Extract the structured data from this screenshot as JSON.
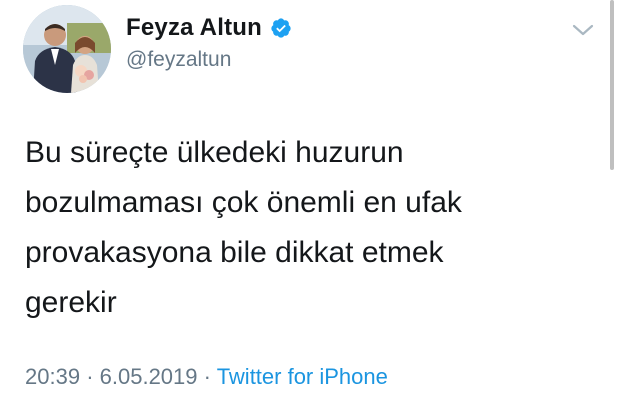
{
  "author": {
    "display_name": "Feyza Altun",
    "handle": "@feyzaltun",
    "verified": true,
    "verified_color": "#1da1f2"
  },
  "tweet": {
    "lines": [
      "Bu süreçte ülkedeki huzurun",
      "bozulmaması çok önemli en ufak",
      "provakasyona bile dikkat etmek",
      "gerekir"
    ]
  },
  "meta": {
    "time": "20:39",
    "separator_1": "·",
    "date": "6.05.2019",
    "separator_2": "·",
    "source": "Twitter for iPhone"
  },
  "icons": {
    "menu": "chevron-down-icon",
    "verified": "verified-badge-icon"
  },
  "colors": {
    "text": "#14171a",
    "secondary": "#657786",
    "link": "#1b95e0"
  }
}
